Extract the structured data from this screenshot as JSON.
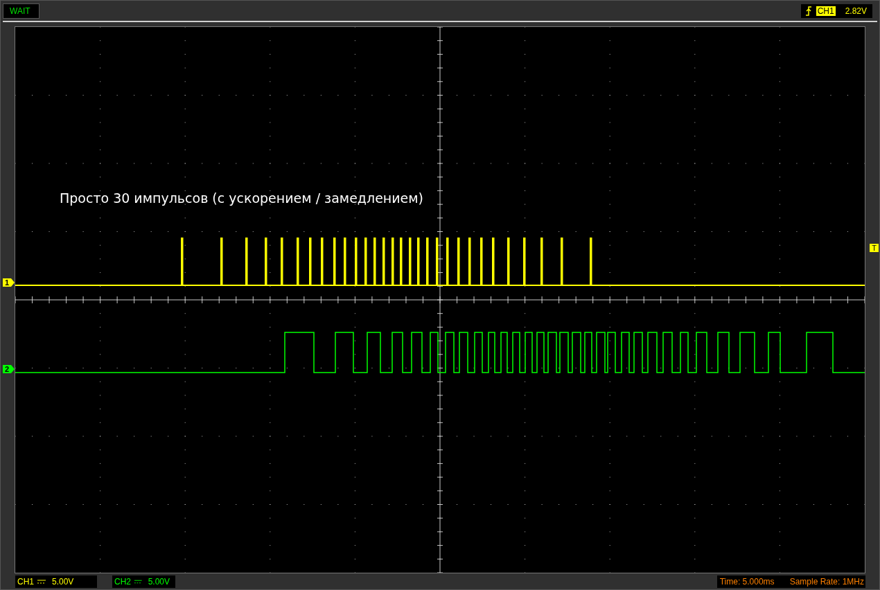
{
  "status": "WAIT",
  "trigger": {
    "source": "CH1",
    "level": "2.82V"
  },
  "annotation": "Просто 30 импульсов (с ускорением / замедлением)",
  "channel_markers": [
    {
      "label": "1",
      "color": "#ffff00"
    },
    {
      "label": "2",
      "color": "#00ff00"
    }
  ],
  "trigger_marker": "T",
  "channels": [
    {
      "name": "CH1",
      "scale": "5.00V",
      "color": "#ffff00"
    },
    {
      "name": "CH2",
      "scale": "5.00V",
      "color": "#00ff00"
    }
  ],
  "time": "Time: 5.000ms",
  "sample_rate": "Sample Rate: 1MHz"
}
